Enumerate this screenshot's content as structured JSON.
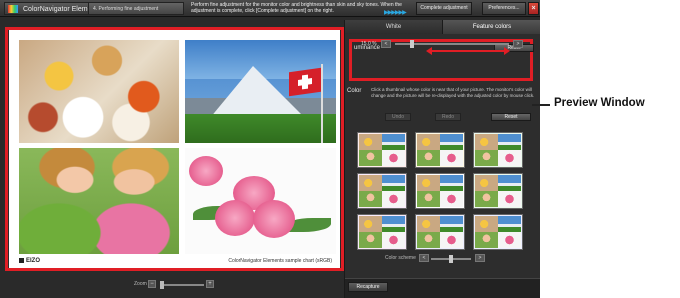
{
  "titlebar": {
    "app_name": "ColorNavigator Elements",
    "step_tab": "4. Performing fine adjustment",
    "instruction": "Perform fine adjustment for the monitor color and brightness than skin and sky tones. When the adjustment is complete, click [Complete adjustment] on the right.",
    "progress_glyphs": "▶▶▶▶▶▶",
    "complete_button": "Complete adjustment",
    "preferences_button": "Preferences...",
    "close_glyph": "×"
  },
  "preview": {
    "logo_text": "EIZO",
    "caption": "ColorNavigator Elements sample chart (sRGB)"
  },
  "zoom": {
    "label": "Zoom",
    "minus": "−",
    "plus": "+",
    "level": 0.05
  },
  "side_panel": {
    "tabs": [
      "White",
      "Feature colors"
    ],
    "active_tab": 1,
    "luminance": {
      "label": "uminance",
      "reset_label": "Reset",
      "value_text": "15.0 %",
      "minus": "<",
      "plus": ">",
      "level": 0.15
    },
    "color": {
      "label": "Color",
      "description": "Click a thumbnail whose color is near that of your picture. The monitor's color will change and the picture will be re-displayed with the adjusted color by mouse click.",
      "undo_label": "Undo",
      "redo_label": "Redo",
      "reset_label": "Reset"
    },
    "color_scheme": {
      "label": "Color scheme",
      "level": 0.5
    },
    "recapture_label": "Recapture"
  },
  "annotation": {
    "callout": "Preview Window",
    "highlight_color": "#e01e25"
  }
}
